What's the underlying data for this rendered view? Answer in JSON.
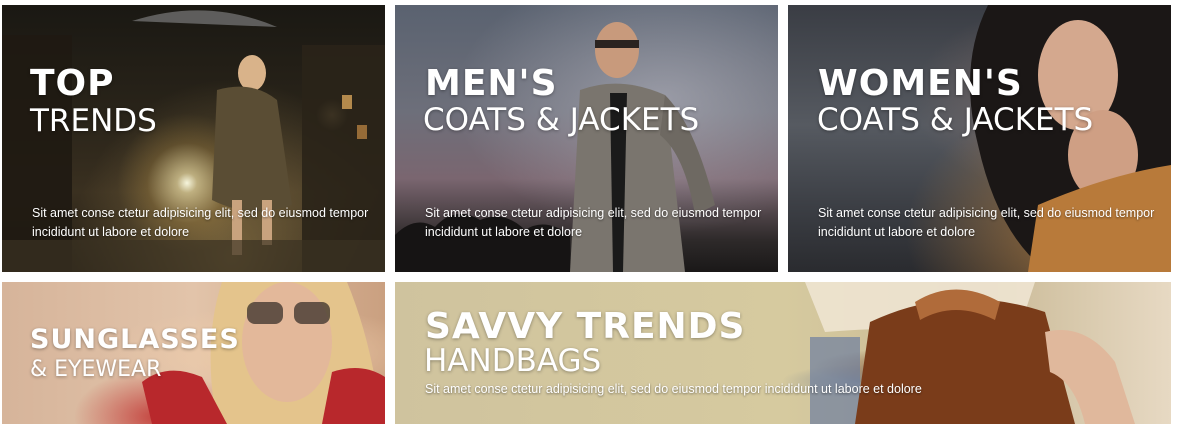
{
  "tiles": [
    {
      "title_line1": "TOP",
      "title_line2": "TRENDS",
      "description": "Sit amet conse ctetur adipisicing elit, sed do eiusmod tempor incididunt ut labore et dolore"
    },
    {
      "title_line1": "MEN'S",
      "title_line2": "COATS & JACKETS",
      "description": "Sit amet conse ctetur adipisicing elit, sed do eiusmod tempor incididunt ut labore et dolore"
    },
    {
      "title_line1": "WOMEN'S",
      "title_line2": "COATS & JACKETS",
      "description": "Sit amet conse ctetur adipisicing elit, sed do eiusmod tempor incididunt ut labore et dolore"
    },
    {
      "title_line1": "SUNGLASSES",
      "title_line2": "& EYEWEAR"
    },
    {
      "title_line1": "SAVVY TRENDS",
      "title_line2": "HANDBAGS",
      "description": "Sit amet conse ctetur adipisicing elit, sed do eiusmod tempor incididunt ut labore et dolore"
    }
  ]
}
